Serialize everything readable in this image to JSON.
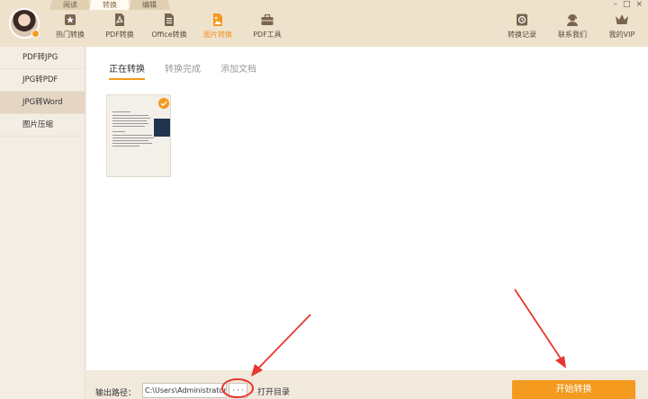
{
  "top_tabs": [
    "阅读",
    "转换",
    "编辑"
  ],
  "window_controls": [
    "–",
    "□",
    "×"
  ],
  "nav_left": [
    {
      "label": "热门转换",
      "icon": "star-icon"
    },
    {
      "label": "PDF转换",
      "icon": "pdf-icon"
    },
    {
      "label": "Office转换",
      "icon": "document-icon"
    },
    {
      "label": "图片转换",
      "icon": "image-icon"
    },
    {
      "label": "PDF工具",
      "icon": "toolbox-icon"
    }
  ],
  "nav_right": [
    {
      "label": "转换记录",
      "icon": "clock-icon"
    },
    {
      "label": "联系我们",
      "icon": "headset-icon"
    },
    {
      "label": "我的VIP",
      "icon": "crown-icon"
    }
  ],
  "sidebar": [
    "PDF转JPG",
    "JPG转PDF",
    "JPG转Word",
    "图片压缩"
  ],
  "subtabs": [
    "正在转换",
    "转换完成",
    "添加文档"
  ],
  "bottom": {
    "output_label": "输出路径：",
    "output_path": "C:\\Users\\Administrator",
    "browse_label": "· · ·",
    "open_dir_label": "打开目录",
    "start_label": "开始转换"
  },
  "colors": {
    "accent": "#f39a1f",
    "annotation": "#e8362f"
  }
}
